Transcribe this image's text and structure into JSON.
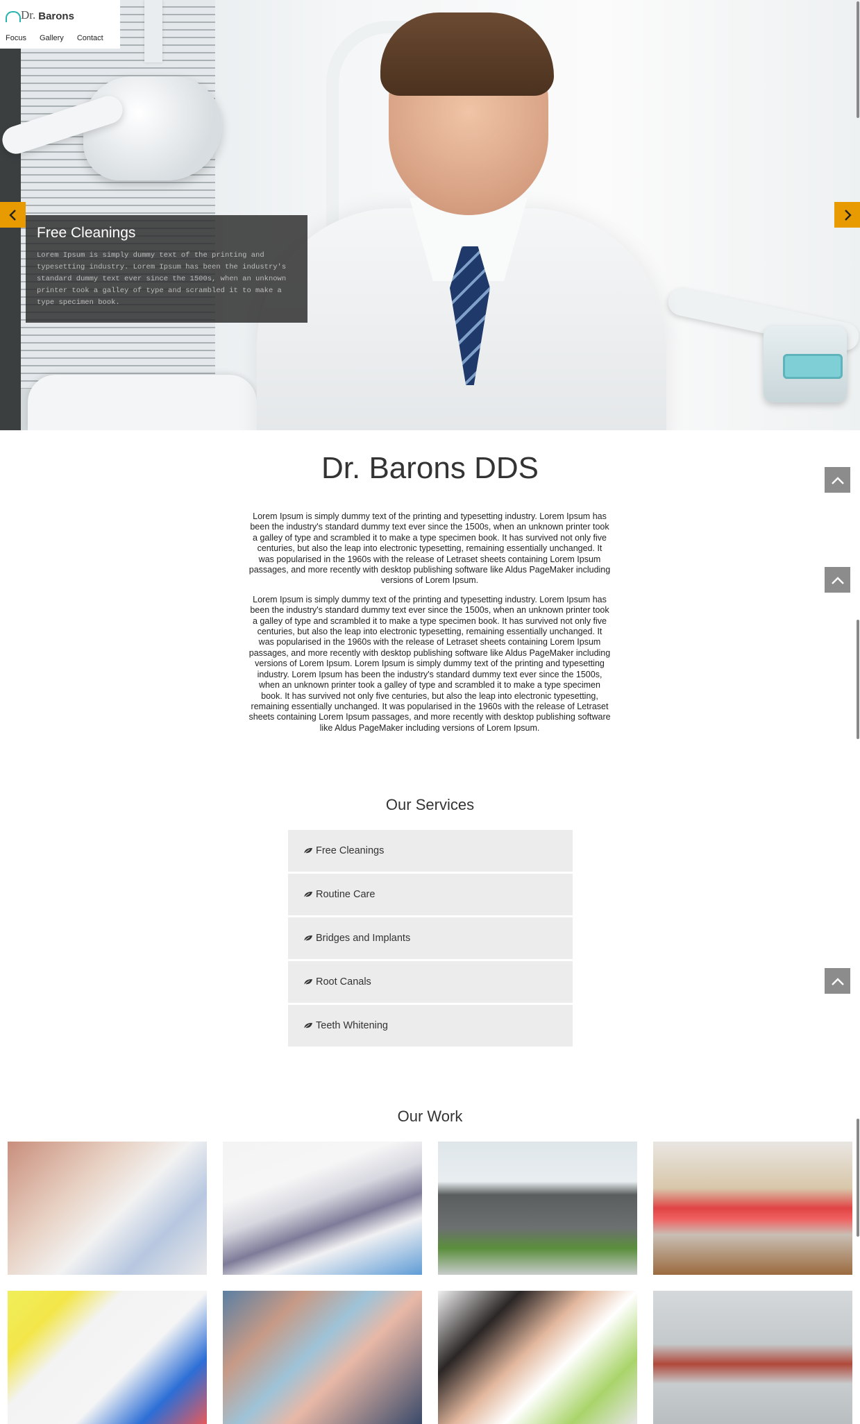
{
  "brand": {
    "dr": "Dr.",
    "name": "Barons"
  },
  "nav": [
    "Focus",
    "Gallery",
    "Contact"
  ],
  "slider": {
    "caption_title": "Free Cleanings",
    "caption_text": "Lorem Ipsum is simply dummy text of the printing and typesetting industry. Lorem Ipsum has been the industry's standard dummy text ever since the 1500s, when an unknown printer took a galley of type and scrambled it to make a type specimen book.",
    "prev_icon": "chevron-left-icon",
    "next_icon": "chevron-right-icon"
  },
  "intro": {
    "title": "Dr. Barons DDS",
    "paragraph1": "Lorem Ipsum is simply dummy text of the printing and typesetting industry. Lorem Ipsum has been the industry's standard dummy text ever since the 1500s, when an unknown printer took a galley of type and scrambled it to make a type specimen book. It has survived not only five centuries, but also the leap into electronic typesetting, remaining essentially unchanged. It was popularised in the 1960s with the release of Letraset sheets containing Lorem Ipsum passages, and more recently with desktop publishing software like Aldus PageMaker including versions of Lorem Ipsum.",
    "paragraph2": "Lorem Ipsum is simply dummy text of the printing and typesetting industry. Lorem Ipsum has been the industry's standard dummy text ever since the 1500s, when an unknown printer took a galley of type and scrambled it to make a type specimen book. It has survived not only five centuries, but also the leap into electronic typesetting, remaining essentially unchanged. It was popularised in the 1960s with the release of Letraset sheets containing Lorem Ipsum passages, and more recently with desktop publishing software like Aldus PageMaker including versions of Lorem Ipsum. Lorem Ipsum is simply dummy text of the printing and typesetting industry. Lorem Ipsum has been the industry's standard dummy text ever since the 1500s, when an unknown printer took a galley of type and scrambled it to make a type specimen book. It has survived not only five centuries, but also the leap into electronic typesetting, remaining essentially unchanged. It was popularised in the 1960s with the release of Letraset sheets containing Lorem Ipsum passages, and more recently with desktop publishing software like Aldus PageMaker including versions of Lorem Ipsum."
  },
  "services": {
    "title": "Our Services",
    "icon": "leaf-icon",
    "items": [
      "Free Cleanings",
      "Routine Care",
      "Bridges and Implants",
      "Root Canals",
      "Teeth Whitening"
    ]
  },
  "work": {
    "title": "Our Work",
    "tiles": [
      "child-dental-exam",
      "dental-xray-review",
      "modern-clinic-building",
      "red-dental-chair",
      "toothbrush-toothpaste",
      "dentist-with-patient",
      "dentist-with-girl",
      "golden-gate-bridge-fog"
    ]
  },
  "colors": {
    "accent": "#e89b00",
    "totop": "#8c8c8c",
    "service_bg": "#ececec",
    "logo_teal": "#2ab3b0"
  },
  "back_to_top_icon": "chevron-up-icon"
}
